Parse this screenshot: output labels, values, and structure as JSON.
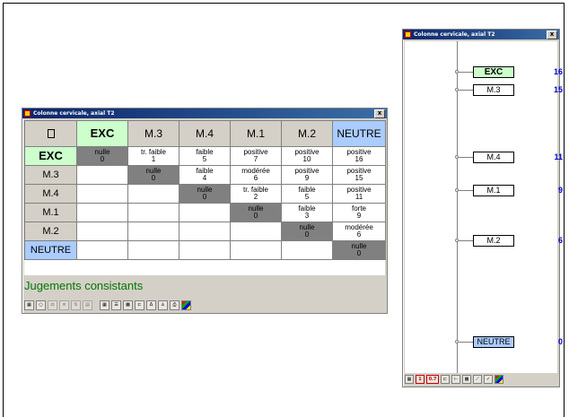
{
  "matrix_window": {
    "title": "Colonne cervicale, axial T2",
    "close_label": "x",
    "columns": [
      "EXC",
      "M.3",
      "M.4",
      "M.1",
      "M.2",
      "NEUTRE"
    ],
    "rows": [
      {
        "label": "EXC",
        "cells": [
          {
            "text": "nulle",
            "num": "0"
          },
          {
            "text": "tr. faible",
            "num": "1"
          },
          {
            "text": "faible",
            "num": "5"
          },
          {
            "text": "positive",
            "num": "7"
          },
          {
            "text": "positive",
            "num": "10"
          },
          {
            "text": "positive",
            "num": "16"
          }
        ]
      },
      {
        "label": "M.3",
        "cells": [
          null,
          {
            "text": "nulle",
            "num": "0"
          },
          {
            "text": "faible",
            "num": "4"
          },
          {
            "text": "modérée",
            "num": "6"
          },
          {
            "text": "positive",
            "num": "9"
          },
          {
            "text": "positive",
            "num": "15"
          }
        ]
      },
      {
        "label": "M.4",
        "cells": [
          null,
          null,
          {
            "text": "nulle",
            "num": "0"
          },
          {
            "text": "tr. faible",
            "num": "2"
          },
          {
            "text": "faible",
            "num": "5"
          },
          {
            "text": "positive",
            "num": "11"
          }
        ]
      },
      {
        "label": "M.1",
        "cells": [
          null,
          null,
          null,
          {
            "text": "nulle",
            "num": "0"
          },
          {
            "text": "faible",
            "num": "3"
          },
          {
            "text": "forte",
            "num": "9"
          }
        ]
      },
      {
        "label": "M.2",
        "cells": [
          null,
          null,
          null,
          null,
          {
            "text": "nulle",
            "num": "0"
          },
          {
            "text": "modérée",
            "num": "6"
          }
        ]
      },
      {
        "label": "NEUTRE",
        "cells": [
          null,
          null,
          null,
          null,
          null,
          {
            "text": "nulle",
            "num": "0"
          }
        ]
      }
    ],
    "status_text": "Jugements consistants"
  },
  "axis_window": {
    "title": "Colonne cervicale, axial T2",
    "close_label": "x",
    "items": [
      {
        "label": "EXC",
        "score": "16"
      },
      {
        "label": "M.3",
        "score": "15"
      },
      {
        "label": "M.4",
        "score": "11"
      },
      {
        "label": "M.1",
        "score": "9"
      },
      {
        "label": "M.2",
        "score": "6"
      },
      {
        "label": "NEUTRE",
        "score": "0"
      }
    ],
    "toolbar_labels": [
      "1",
      "0.7"
    ]
  },
  "colors": {
    "exc_green": "#ccffcc",
    "neutre_blue": "#aaccff",
    "diagonal_grey": "#808080",
    "status_green": "#007700",
    "score_blue": "#0000cc"
  }
}
